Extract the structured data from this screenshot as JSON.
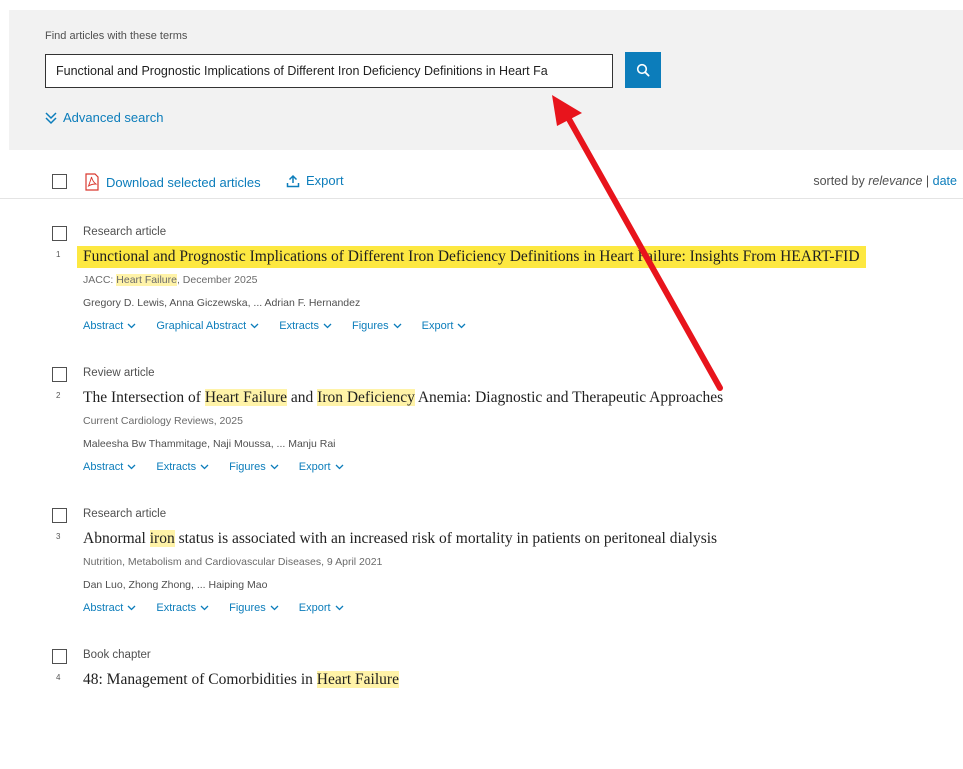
{
  "search": {
    "label": "Find articles with these terms",
    "value": "Functional and Prognostic Implications of Different Iron Deficiency Definitions in Heart Fa",
    "advanced_label": "Advanced search"
  },
  "toolbar": {
    "download_label": "Download selected articles",
    "export_label": "Export",
    "sorted_by_prefix": "sorted by",
    "sort_relevance": "relevance",
    "sort_sep": "|",
    "sort_date": "date"
  },
  "results": [
    {
      "number": "1",
      "type": "Research article",
      "title_parts": [
        {
          "text": "Functional and Prognostic Implications of Different Iron Deficiency Definitions in Heart Failure: Insights From HEART-FID",
          "hl": false
        }
      ],
      "source_parts": [
        {
          "text": "JACC: ",
          "hl": false
        },
        {
          "text": "Heart Failure",
          "hl": true
        },
        {
          "text": ", December 2025",
          "hl": false
        }
      ],
      "authors": "Gregory D. Lewis, Anna Giczewska, ... Adrian F. Hernandez",
      "actions": [
        "Abstract",
        "Graphical Abstract",
        "Extracts",
        "Figures",
        "Export"
      ]
    },
    {
      "number": "2",
      "type": "Review article",
      "title_parts": [
        {
          "text": "The Intersection of ",
          "hl": false
        },
        {
          "text": "Heart Failure",
          "hl": true
        },
        {
          "text": " and ",
          "hl": false
        },
        {
          "text": "Iron Deficiency",
          "hl": true
        },
        {
          "text": " Anemia: Diagnostic and Therapeutic Approaches",
          "hl": false
        }
      ],
      "source_parts": [
        {
          "text": "Current Cardiology Reviews, 2025",
          "hl": false
        }
      ],
      "authors": "Maleesha Bw Thammitage, Naji Moussa, ... Manju Rai",
      "actions": [
        "Abstract",
        "Extracts",
        "Figures",
        "Export"
      ]
    },
    {
      "number": "3",
      "type": "Research article",
      "title_parts": [
        {
          "text": "Abnormal ",
          "hl": false
        },
        {
          "text": "iron",
          "hl": true
        },
        {
          "text": " status is associated with an increased risk of mortality in patients on peritoneal dialysis",
          "hl": false
        }
      ],
      "source_parts": [
        {
          "text": "Nutrition, Metabolism and Cardiovascular Diseases, 9 April 2021",
          "hl": false
        }
      ],
      "authors": "Dan Luo, Zhong Zhong, ... Haiping Mao",
      "actions": [
        "Abstract",
        "Extracts",
        "Figures",
        "Export"
      ]
    },
    {
      "number": "4",
      "type": "Book chapter",
      "title_parts": [
        {
          "text": "48: Management of Comorbidities in ",
          "hl": false
        },
        {
          "text": "Heart Failure",
          "hl": true
        }
      ],
      "source_parts": [],
      "authors": "",
      "actions": []
    }
  ],
  "colors": {
    "link": "#0c7dbb",
    "title_highlight": "#fde841",
    "term_highlight": "#fff3a8",
    "annotation_arrow": "#e8141c"
  },
  "icons": {
    "search_button": "magnifier-icon",
    "advanced": "double-chevron-down-icon",
    "download": "pdf-icon",
    "export": "upload-icon",
    "dropdown": "chevron-down-icon"
  }
}
